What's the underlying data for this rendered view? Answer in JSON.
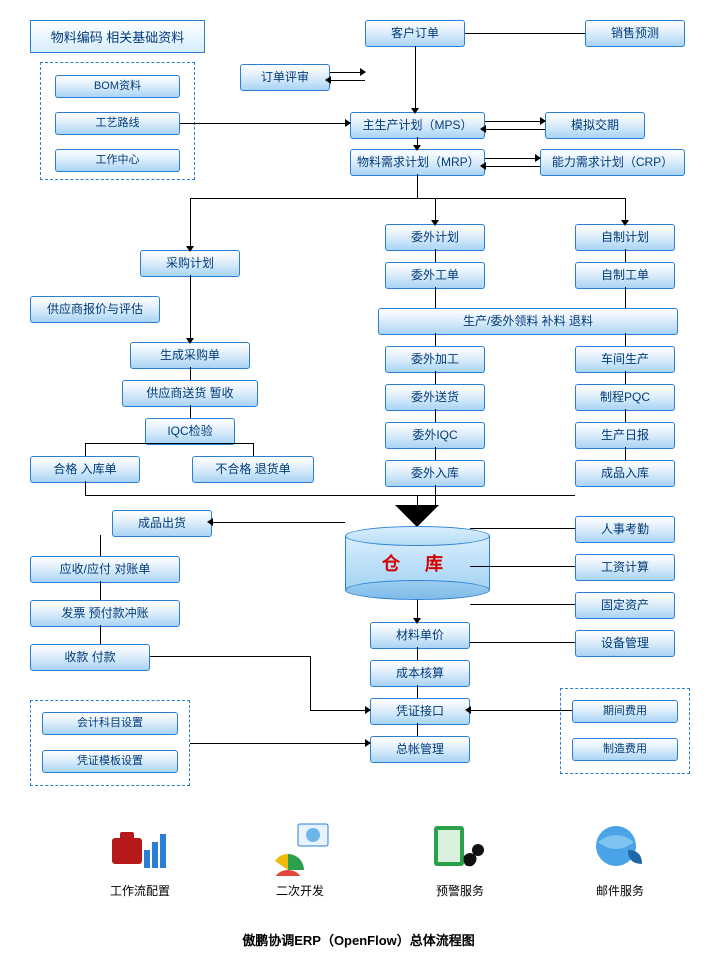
{
  "header": {
    "material_code": "物料编码 相关基础资料",
    "customer_order": "客户订单",
    "sales_forecast": "销售预测"
  },
  "left_group": {
    "bom": "BOM资料",
    "routing": "工艺路线",
    "wc": "工作中心"
  },
  "top_center": {
    "order_review": "订单评审",
    "mps": "主生产计划（MPS）",
    "simulate_due": "模拟交期",
    "mrp": "物料需求计划（MRP）",
    "crp": "能力需求计划（CRP）"
  },
  "procure": {
    "plan": "采购计划",
    "supplier_quote": "供应商报价与评估",
    "gen_po": "生成采购单",
    "supplier_ship": "供应商送货  暂收",
    "iqc": "IQC检验",
    "pass_in": "合格  入库单",
    "fail_return": "不合格  退货单"
  },
  "outsource": {
    "plan": "委外计划",
    "wo": "委外工单",
    "picking": "生产/委外领料  补料  退料",
    "process": "委外加工",
    "ship": "委外送货",
    "iqc": "委外IQC",
    "instore": "委外入库"
  },
  "inhouse": {
    "plan": "自制计划",
    "wo": "自制工单",
    "shop": "车间生产",
    "pqc": "制程PQC",
    "daily": "生产日报",
    "fg_in": "成品入库"
  },
  "finance_left": {
    "ship_out": "成品出货",
    "ar_ap": "应收/应付  对账单",
    "invoice": "发票  预付款冲账",
    "pay": "收款  付款"
  },
  "cost_center": {
    "warehouse": "仓 库",
    "unit_price": "材料单价",
    "costing": "成本核算",
    "voucher_if": "凭证接口",
    "gl": "总帐管理"
  },
  "hr_right": {
    "attendance": "人事考勤",
    "payroll": "工资计算",
    "fixed_asset": "固定资产",
    "equip": "设备管理"
  },
  "settings_left": {
    "coa": "会计科目设置",
    "vtpl": "凭证模板设置"
  },
  "period_right": {
    "period_exp": "期间费用",
    "mfg_exp": "制造费用"
  },
  "footer_icons": {
    "wf": "工作流配置",
    "dev": "二次开发",
    "alert": "预警服务",
    "mail": "邮件服务"
  },
  "caption": "傲鹏协调ERP（OpenFlow）总体流程图"
}
